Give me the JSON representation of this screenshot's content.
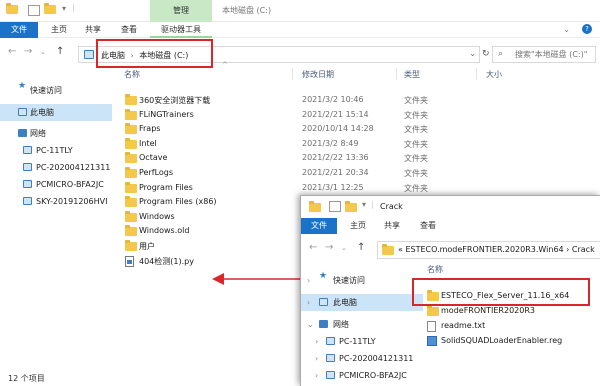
{
  "main": {
    "context_tab": "管理",
    "title": "本地磁盘 (C:)",
    "ribbon_tabs": [
      "文件",
      "主页",
      "共享",
      "查看",
      "驱动器工具"
    ],
    "breadcrumb": [
      "此电脑",
      "本地磁盘 (C:)"
    ],
    "search_placeholder": "搜索\"本地磁盘 (C:)\"",
    "sidebar": [
      {
        "label": "快速访问",
        "icon": "star-icon"
      },
      {
        "label": "此电脑",
        "icon": "pc-icon",
        "selected": true
      },
      {
        "label": "网络",
        "icon": "network-icon"
      },
      {
        "label": "PC-11TLY",
        "icon": "pc-icon"
      },
      {
        "label": "PC-202004121311",
        "icon": "pc-icon"
      },
      {
        "label": "PCMICRO-BFA2JC",
        "icon": "pc-icon"
      },
      {
        "label": "SKY-20191206HVI",
        "icon": "pc-icon"
      }
    ],
    "columns": {
      "name": "名称",
      "date": "修改日期",
      "type": "类型",
      "size": "大小"
    },
    "files": [
      {
        "name": "360安全浏览器下载",
        "date": "2021/3/2 10:46",
        "type": "文件夹"
      },
      {
        "name": "FLiNGTrainers",
        "date": "2021/2/21 15:14",
        "type": "文件夹"
      },
      {
        "name": "Fraps",
        "date": "2020/10/14 14:28",
        "type": "文件夹"
      },
      {
        "name": "Intel",
        "date": "2021/3/2 8:49",
        "type": "文件夹"
      },
      {
        "name": "Octave",
        "date": "2021/2/22 13:36",
        "type": "文件夹"
      },
      {
        "name": "PerfLogs",
        "date": "2021/2/21 20:34",
        "type": "文件夹"
      },
      {
        "name": "Program Files",
        "date": "2021/3/1 12:25",
        "type": "文件夹"
      },
      {
        "name": "Program Files (x86)",
        "date": "",
        "type": ""
      },
      {
        "name": "Windows",
        "date": "",
        "type": ""
      },
      {
        "name": "Windows.old",
        "date": "",
        "type": ""
      },
      {
        "name": "用户",
        "date": "",
        "type": ""
      },
      {
        "name": "404检测(1).py",
        "date": "",
        "type": "",
        "icon": "python-file-icon"
      }
    ],
    "status": "12 个项目"
  },
  "second": {
    "title": "Crack",
    "ribbon_tabs": [
      "文件",
      "主页",
      "共享",
      "查看"
    ],
    "breadcrumb": "« ESTECO.modeFRONTIER.2020R3.Win64 › Crack",
    "sidebar": [
      {
        "label": "快速访问",
        "icon": "star-icon"
      },
      {
        "label": "此电脑",
        "icon": "pc-icon",
        "selected": true
      },
      {
        "label": "网络",
        "icon": "network-icon"
      },
      {
        "label": "PC-11TLY",
        "icon": "pc-icon"
      },
      {
        "label": "PC-202004121311",
        "icon": "pc-icon"
      },
      {
        "label": "PCMICRO-BFA2JC",
        "icon": "pc-icon"
      }
    ],
    "column_name": "名称",
    "files": [
      {
        "name": "ESTECO_Flex_Server_11.16_x64",
        "icon": "folder-icon"
      },
      {
        "name": "modeFRONTIER2020R3",
        "icon": "folder-icon"
      },
      {
        "name": "readme.txt",
        "icon": "text-file-icon"
      },
      {
        "name": "SolidSQUADLoaderEnabler.reg",
        "icon": "registry-file-icon"
      }
    ]
  },
  "colors": {
    "accent_blue": "#1a73c9",
    "context_green": "#c9e8c6",
    "selection": "#cce4f7",
    "highlight_red": "#d9262b"
  }
}
